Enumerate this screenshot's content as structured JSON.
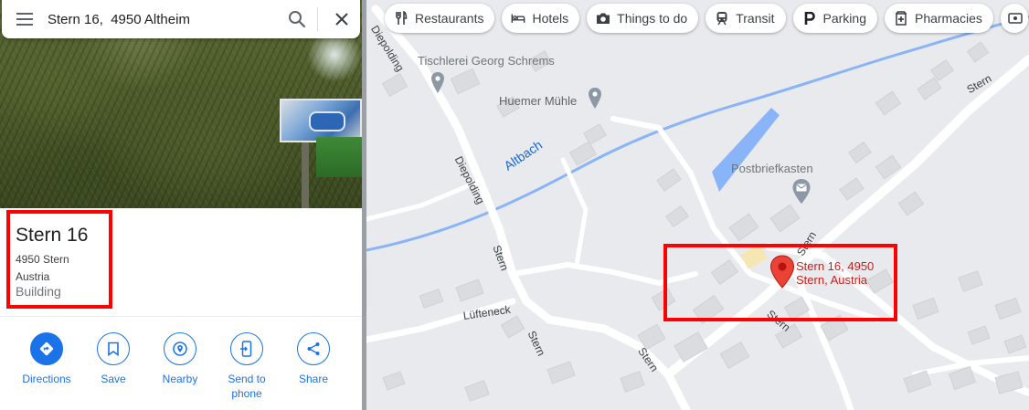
{
  "search": {
    "query": "Stern 16,  4950 Altheim",
    "icons": {
      "menu": "hamburger-menu-icon",
      "search": "magnifier-icon",
      "close": "x-close-icon"
    }
  },
  "place": {
    "title": "Stern 16",
    "address_line1": "4950 Stern",
    "address_line2": "Austria",
    "type": "Building"
  },
  "actions": [
    {
      "label": "Directions",
      "icon": "directions-icon"
    },
    {
      "label": "Save",
      "icon": "bookmark-icon"
    },
    {
      "label": "Nearby",
      "icon": "nearby-icon"
    },
    {
      "label": "Send to phone",
      "label_line1": "Send to",
      "label_line2": "phone",
      "icon": "phone-send-icon"
    },
    {
      "label": "Share",
      "icon": "share-icon"
    }
  ],
  "chips": [
    {
      "label": "Restaurants",
      "icon": "fork-knife-icon"
    },
    {
      "label": "Hotels",
      "icon": "bed-icon"
    },
    {
      "label": "Things to do",
      "icon": "camera-icon"
    },
    {
      "label": "Transit",
      "icon": "train-icon"
    },
    {
      "label": "Parking",
      "icon": "parking-icon"
    },
    {
      "label": "Pharmacies",
      "icon": "pharmacy-icon"
    }
  ],
  "map": {
    "pois": [
      {
        "name": "Tischlerei Georg Schrems"
      },
      {
        "name": "Huemer Mühle"
      },
      {
        "name": "Postbriefkasten"
      }
    ],
    "water_label": "Altbach",
    "roads": {
      "diepolding_top": "Diepolding",
      "diepolding": "Diepolding",
      "stern_a": "Stern",
      "stern_b": "Stern",
      "stern_c": "Stern",
      "stern_d": "Stern",
      "stern_e": "Stern",
      "stern_f": "Stern",
      "luefteneck": "Lüfteneck"
    },
    "marker": {
      "line1": "Stern 16, 4950",
      "line2": "Stern, Austria"
    }
  },
  "colors": {
    "accent": "#1a73e8",
    "highlight": "#ff0000",
    "marker": "#ea4335",
    "marker_label": "#c5221f",
    "water": "#8ab4f8",
    "map_bg": "#e8eaed"
  }
}
